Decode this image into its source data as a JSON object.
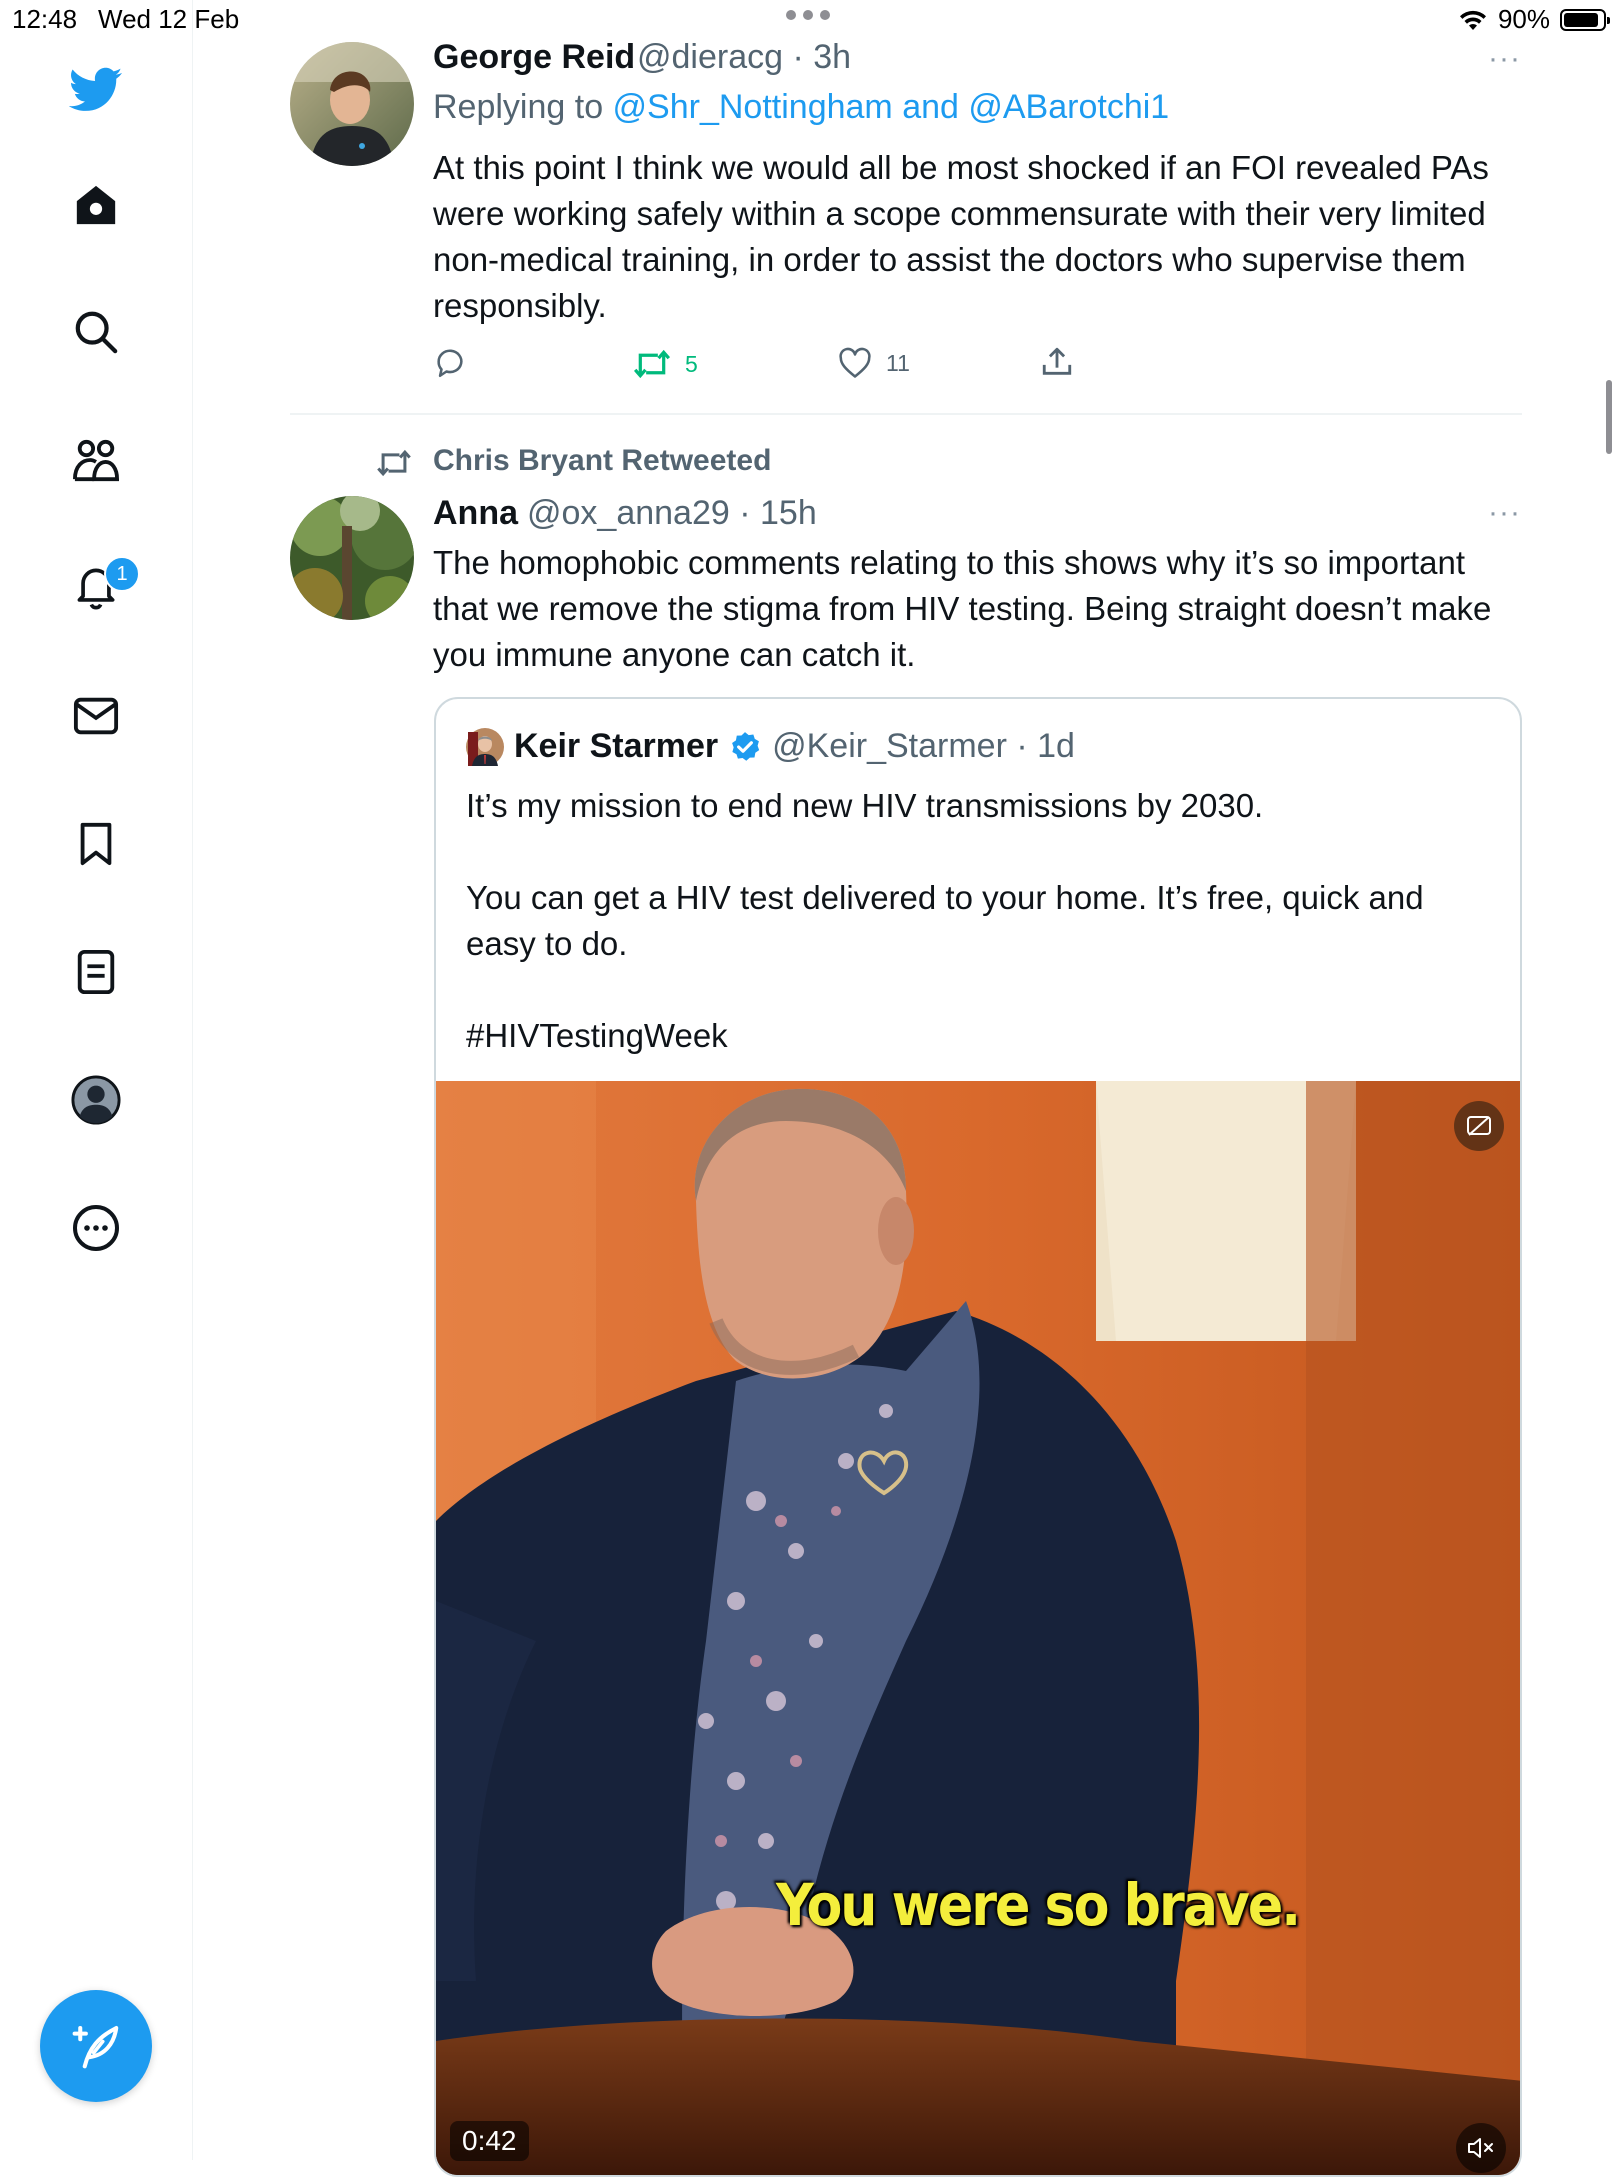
{
  "status_bar": {
    "time": "12:48",
    "date": "Wed 12 Feb",
    "battery": "90%",
    "battery_level": 0.9
  },
  "sidebar": {
    "items": [
      {
        "name": "twitter-logo",
        "icon": "bird-icon"
      },
      {
        "name": "home",
        "icon": "home-icon"
      },
      {
        "name": "search",
        "icon": "search-icon"
      },
      {
        "name": "communities",
        "icon": "communities-icon"
      },
      {
        "name": "notifications",
        "icon": "bell-icon",
        "badge": "1"
      },
      {
        "name": "messages",
        "icon": "envelope-icon"
      },
      {
        "name": "bookmarks",
        "icon": "bookmark-icon"
      },
      {
        "name": "lists",
        "icon": "list-icon"
      },
      {
        "name": "profile",
        "icon": "avatar-icon"
      },
      {
        "name": "more",
        "icon": "more-circle-icon"
      }
    ],
    "compose_icon": "compose-feather-icon"
  },
  "tweets": [
    {
      "author": "George Reid",
      "handle": "@dieracg",
      "time": "· 3h",
      "reply_prefix": "Replying to ",
      "reply_to": "@Shr_Nottingham and @ABarotchi1",
      "text": "At this point I think we would all be most shocked if an FOI revealed PAs were working safely within a scope commensurate with their very limited non-medical training, in order to assist the doctors who supervise them responsibly.",
      "retweets": "5",
      "likes": "11",
      "more": "···"
    },
    {
      "retweeted_by": "Chris Bryant Retweeted",
      "author": "Anna",
      "handle": "@ox_anna29",
      "time": "· 15h",
      "text": "The homophobic comments relating to this shows why it’s so important that we remove the stigma from HIV testing. Being straight doesn’t make you immune anyone can catch it.",
      "more": "···",
      "quote": {
        "author": "Keir Starmer",
        "handle": "@Keir_Starmer",
        "time": "· 1d",
        "verified": true,
        "paragraphs": [
          "It’s my mission to end new HIV transmissions by 2030.",
          "You can get a HIV test delivered to your home. It’s free, quick and easy to do.",
          "#HIVTestingWeek"
        ],
        "video": {
          "caption": "You were so brave.",
          "duration": "0:42"
        }
      }
    }
  ],
  "colors": {
    "accent": "#1d9bf0",
    "retweet_green": "#00ba7c",
    "text_secondary": "#536471"
  }
}
